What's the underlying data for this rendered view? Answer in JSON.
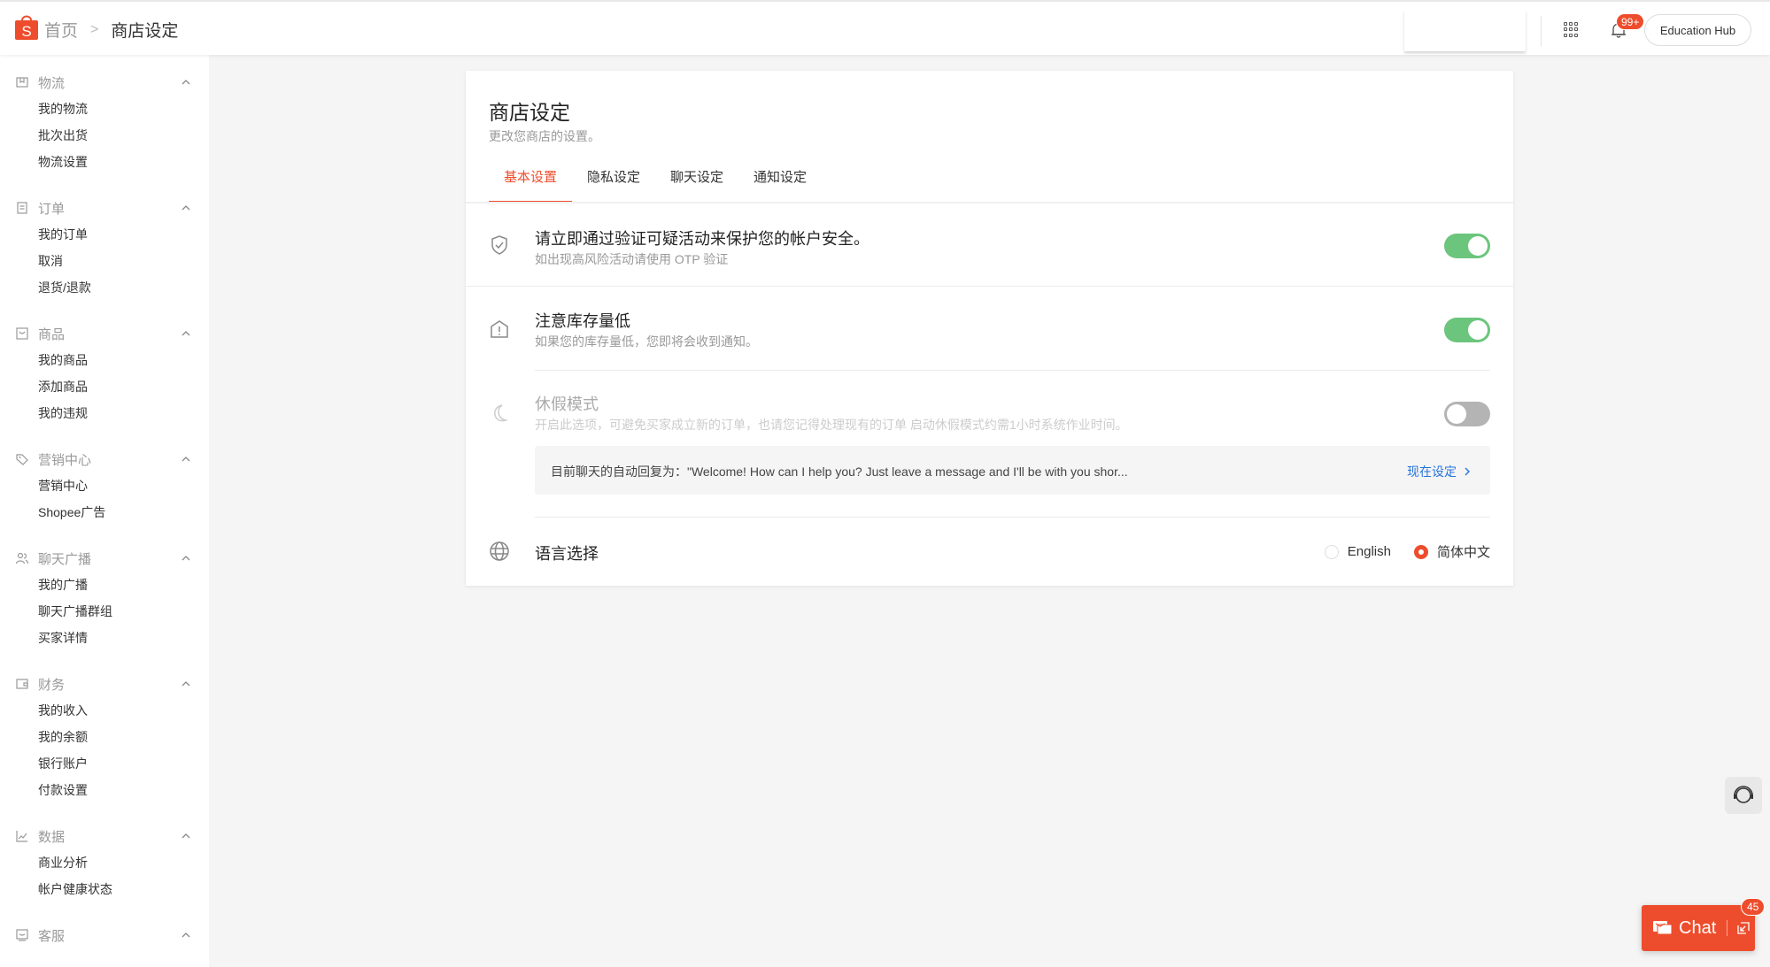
{
  "header": {
    "breadcrumb_home": "首页",
    "breadcrumb_current": "商店设定",
    "notification_badge": "99+",
    "education_hub_label": "Education Hub"
  },
  "sidebar": {
    "groups": [
      {
        "label": "物流",
        "icon": "box-icon",
        "items": [
          "我的物流",
          "批次出货",
          "物流设置"
        ]
      },
      {
        "label": "订单",
        "icon": "clipboard-icon",
        "items": [
          "我的订单",
          "取消",
          "退货/退款"
        ]
      },
      {
        "label": "商品",
        "icon": "bag-icon",
        "items": [
          "我的商品",
          "添加商品",
          "我的违规"
        ]
      },
      {
        "label": "营销中心",
        "icon": "tag-icon",
        "items": [
          "营销中心",
          "Shopee广告"
        ]
      },
      {
        "label": "聊天广播",
        "icon": "users-icon",
        "items": [
          "我的广播",
          "聊天广播群组",
          "买家详情"
        ]
      },
      {
        "label": "财务",
        "icon": "wallet-icon",
        "items": [
          "我的收入",
          "我的余额",
          "银行账户",
          "付款设置"
        ]
      },
      {
        "label": "数据",
        "icon": "chart-icon",
        "items": [
          "商业分析",
          "帐户健康状态"
        ]
      },
      {
        "label": "客服",
        "icon": "message-icon",
        "items": []
      }
    ]
  },
  "main": {
    "title": "商店设定",
    "subtitle": "更改您商店的设置。",
    "tabs": [
      {
        "label": "基本设置",
        "active": true
      },
      {
        "label": "隐私设定",
        "active": false
      },
      {
        "label": "聊天设定",
        "active": false
      },
      {
        "label": "通知设定",
        "active": false
      }
    ],
    "settings": {
      "security": {
        "title": "请立即通过验证可疑活动来保护您的帐户安全。",
        "desc": "如出现高风险活动请使用 OTP 验证",
        "enabled": true
      },
      "low_stock": {
        "title": "注意库存量低",
        "desc": "如果您的库存量低，您即将会收到通知。",
        "enabled": true
      },
      "vacation": {
        "title": "休假模式",
        "desc": "开启此选项，可避免买家成立新的订单，也请您记得处理现有的订单 启动休假模式约需1小时系统作业时间。",
        "enabled": false
      },
      "autoreply": {
        "text": "目前聊天的自动回复为：\"Welcome! How can I help you? Just leave a message and I'll be with you shor...",
        "link": "现在设定"
      },
      "language": {
        "title": "语言选择",
        "options": [
          "English",
          "简体中文"
        ],
        "selected": "简体中文"
      }
    }
  },
  "floating": {
    "chat_label": "Chat",
    "chat_badge": "45"
  },
  "colors": {
    "brand": "#ee4d2d",
    "toggle_on": "#6cc57c",
    "link": "#2673dd"
  }
}
